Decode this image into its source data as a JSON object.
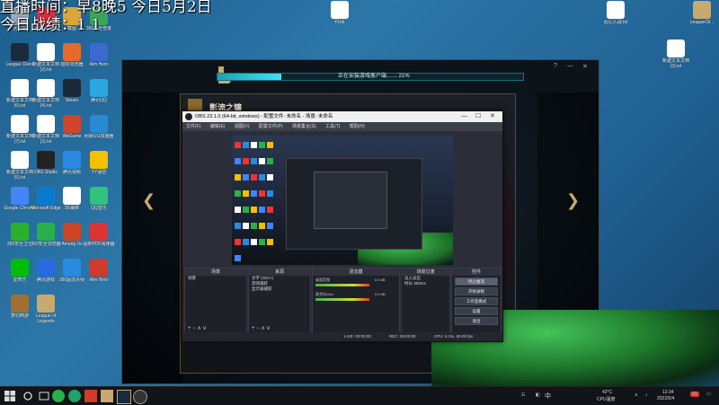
{
  "overlay": {
    "line1": "直播时间：早8晚5  今日5月2日",
    "line2": "今日战绩：1    1"
  },
  "desktop_icons": [
    {
      "label": "回收站",
      "color": "#9ab"
    },
    {
      "label": "网易云音乐",
      "color": "#e02b3b"
    },
    {
      "label": "截图",
      "color": "#d9a63a"
    },
    {
      "label": "360安全管家",
      "color": "#3aa55a"
    },
    {
      "label": "League Client",
      "color": "#1a2a3a"
    },
    {
      "label": "新建文本文档 (2).txt",
      "color": "#fff"
    },
    {
      "label": "猎豹浏览器",
      "color": "#e86a2a"
    },
    {
      "label": "Aim Hero",
      "color": "#3a6ad0"
    },
    {
      "label": "新建文本文档 (6).txt",
      "color": "#fff"
    },
    {
      "label": "新建文本文档 (4).txt",
      "color": "#fff"
    },
    {
      "label": "Steam",
      "color": "#1b2838"
    },
    {
      "label": "腾讯QQ",
      "color": "#2ba6e0"
    },
    {
      "label": "新建文本文档 (7).txt",
      "color": "#fff"
    },
    {
      "label": "新建文本文档 (3).txt",
      "color": "#fff"
    },
    {
      "label": "WeGame",
      "color": "#d0452a"
    },
    {
      "label": "网易UU加速器",
      "color": "#2a8ad0"
    },
    {
      "label": "新建文本文档 (5).txt",
      "color": "#fff"
    },
    {
      "label": "OBS Studio",
      "color": "#222"
    },
    {
      "label": "腾讯视频",
      "color": "#2a8ae0"
    },
    {
      "label": "YY语音",
      "color": "#f5c000"
    },
    {
      "label": "Google Chrome",
      "color": "#4285f4"
    },
    {
      "label": "Microsoft Edge",
      "color": "#0a7ad0"
    },
    {
      "label": "55海峡",
      "color": "#fff"
    },
    {
      "label": "QQ音乐",
      "color": "#31c27c"
    },
    {
      "label": "360安全卫士",
      "color": "#2ab02a"
    },
    {
      "label": "360安全浏览器",
      "color": "#2ab04a"
    },
    {
      "label": "Among Us",
      "color": "#c42"
    },
    {
      "label": "福昕PDF阅读器",
      "color": "#d33"
    },
    {
      "label": "爱奇艺",
      "color": "#00be06"
    },
    {
      "label": "腾讯游戏",
      "color": "#2a6ae0"
    },
    {
      "label": "360驱动大师",
      "color": "#2a8ae0"
    },
    {
      "label": "Aim Hero",
      "color": "#d03a2a"
    },
    {
      "label": "梦幻西游",
      "color": "#a07030"
    },
    {
      "label": "League of Legends",
      "color": "#c8aa6e"
    },
    {
      "label": "FI.txt",
      "color": "#fff"
    },
    {
      "label": "回心入战.txt",
      "color": "#fff"
    },
    {
      "label": "新建文本文档 (3).txt",
      "color": "#fff"
    },
    {
      "label": "LeagueCli...",
      "color": "#c8aa6e"
    }
  ],
  "lol_client": {
    "status": "正在安装游戏客户端……  21%",
    "progress": 0.21,
    "panel_title": "影流之镰",
    "arrow_left": "❮",
    "arrow_right": "❯",
    "controls": [
      "?",
      "—",
      "✕"
    ]
  },
  "obs": {
    "title": "OBS 23.1.0 (64-bit, windows) - 配置文件: 未命名 - 场景: 未命名",
    "win_min": "—",
    "win_max": "☐",
    "win_close": "✕",
    "menu": [
      "文件(F)",
      "编辑(E)",
      "视图(V)",
      "配置文件(P)",
      "场景集合(S)",
      "工具(T)",
      "帮助(H)"
    ],
    "docks": {
      "scenes": {
        "title": "场景",
        "items": [
          "场景"
        ]
      },
      "sources": {
        "title": "来源",
        "items": [
          "文字 (GDI+)",
          "游戏捕获",
          "显示器捕获"
        ]
      },
      "mixer": {
        "title": "混音器",
        "channels": [
          {
            "name": "桌面音频",
            "value": "0.0 dB"
          },
          {
            "name": "麦克风/Aux",
            "value": "0.0 dB"
          }
        ]
      },
      "transitions": {
        "title": "场景过渡",
        "type": "淡入淡出",
        "duration_label": "时长",
        "duration": "300ms"
      },
      "controls": {
        "title": "控件",
        "buttons": [
          "停止推流",
          "开始录制",
          "工作室模式",
          "设置",
          "退出"
        ]
      }
    },
    "dock_footer": "+  −  ∧  ∨",
    "status": {
      "live": "LIVE: 00:00:00",
      "rec": "REC: 00:00:00",
      "cpu": "CPU: 9.1%, 60.00 fps"
    }
  },
  "taskbar": {
    "temp": "42°C",
    "temp_label": "CPU温度",
    "time": "12:34",
    "date": "2022/5/4",
    "ime": "中",
    "notifications": "21"
  }
}
